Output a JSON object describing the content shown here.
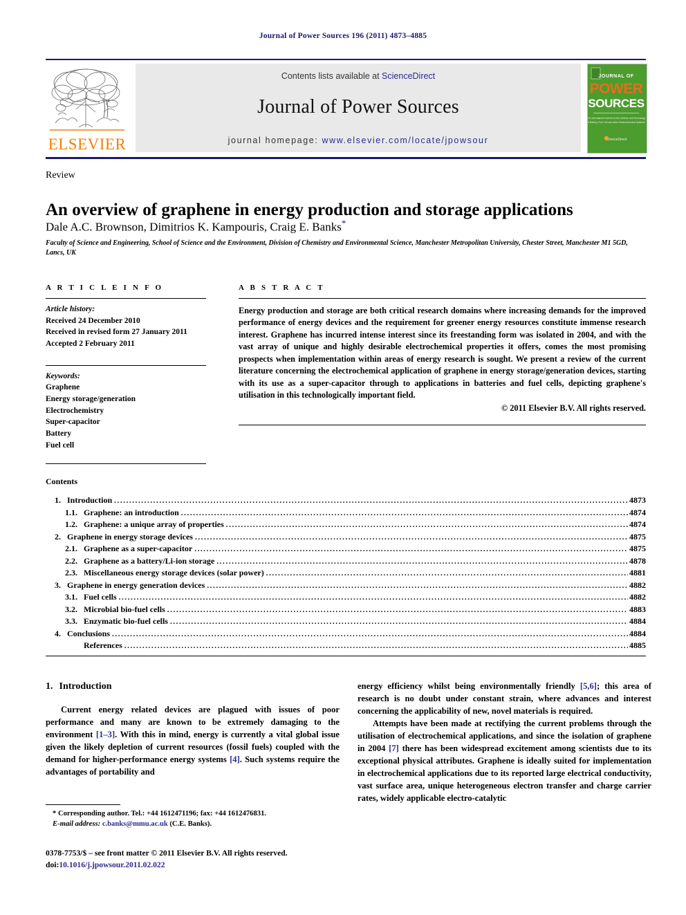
{
  "running_head": "Journal of Power Sources 196 (2011) 4873–4885",
  "masthead": {
    "contents_prefix": "Contents lists available at ",
    "sciencedirect": "ScienceDirect",
    "journal_name": "Journal of Power Sources",
    "homepage_prefix": "journal homepage: ",
    "homepage_url": "www.elsevier.com/locate/jpowsour",
    "publisher_logo_text": "ELSEVIER",
    "cover": {
      "line1": "JOURNAL OF",
      "line2": "POWER",
      "line3": "SOURCES",
      "blurb": "The International Journal on the Science and Technology of Battery, Fuel Cell and other Electrochemical Systems",
      "footer": "ScienceDirect"
    },
    "colors": {
      "elsevier_orange": "#F08000",
      "link_blue": "#2b2b8f",
      "rule_navy": "#1a1a6e",
      "cover_green": "#4c9c2e"
    }
  },
  "article": {
    "doctype": "Review",
    "title": "An overview of graphene in energy production and storage applications",
    "authors": "Dale A.C. Brownson, Dimitrios K. Kampouris, Craig E. Banks",
    "author_star": "*",
    "affiliation": "Faculty of Science and Engineering, School of Science and the Environment, Division of Chemistry and Environmental Science, Manchester Metropolitan University, Chester Street, Manchester M1 5GD, Lancs, UK"
  },
  "article_info": {
    "heading": "A R T I C L E    I N F O",
    "history_label": "Article history:",
    "history": [
      "Received 24 December 2010",
      "Received in revised form 27 January 2011",
      "Accepted 2 February 2011"
    ],
    "keywords_label": "Keywords:",
    "keywords": [
      "Graphene",
      "Energy storage/generation",
      "Electrochemistry",
      "Super-capacitor",
      "Battery",
      "Fuel cell"
    ]
  },
  "abstract": {
    "heading": "A B S T R A C T",
    "text": "Energy production and storage are both critical research domains where increasing demands for the improved performance of energy devices and the requirement for greener energy resources constitute immense research interest. Graphene has incurred intense interest since its freestanding form was isolated in 2004, and with the vast array of unique and highly desirable electrochemical properties it offers, comes the most promising prospects when implementation within areas of energy research is sought. We present a review of the current literature concerning the electrochemical application of graphene in energy storage/generation devices, starting with its use as a super-capacitor through to applications in batteries and fuel cells, depicting graphene's utilisation in this technologically important field.",
    "copyright": "© 2011 Elsevier B.V. All rights reserved."
  },
  "contents": {
    "heading": "Contents",
    "entries": [
      {
        "num": "1.",
        "label": "Introduction",
        "page": "4873",
        "level": 0
      },
      {
        "num": "1.1.",
        "label": "Graphene: an introduction",
        "page": "4874",
        "level": 1
      },
      {
        "num": "1.2.",
        "label": "Graphene: a unique array of properties",
        "page": "4874",
        "level": 1
      },
      {
        "num": "2.",
        "label": "Graphene in energy storage devices",
        "page": "4875",
        "level": 0
      },
      {
        "num": "2.1.",
        "label": "Graphene as a super-capacitor",
        "page": "4875",
        "level": 1
      },
      {
        "num": "2.2.",
        "label": "Graphene as a battery/Li-ion storage",
        "page": "4878",
        "level": 1
      },
      {
        "num": "2.3.",
        "label": "Miscellaneous energy storage devices (solar power)",
        "page": "4881",
        "level": 1
      },
      {
        "num": "3.",
        "label": "Graphene in energy generation devices",
        "page": "4882",
        "level": 0
      },
      {
        "num": "3.1.",
        "label": "Fuel cells",
        "page": "4882",
        "level": 1
      },
      {
        "num": "3.2.",
        "label": "Microbial bio-fuel cells",
        "page": "4883",
        "level": 1
      },
      {
        "num": "3.3.",
        "label": "Enzymatic bio-fuel cells",
        "page": "4884",
        "level": 1
      },
      {
        "num": "4.",
        "label": "Conclusions",
        "page": "4884",
        "level": 0
      },
      {
        "num": "",
        "label": "References",
        "page": "4885",
        "level": 1
      }
    ]
  },
  "body": {
    "section_number": "1.",
    "section_title": "Introduction",
    "left_paragraph_parts": {
      "p1_a": "Current energy related devices are plagued with issues of poor performance and many are known to be extremely damaging to the environment ",
      "p1_cite1": "[1–3]",
      "p1_b": ". With this in mind, energy is currently a vital global issue given the likely depletion of current resources (fossil fuels) coupled with the demand for higher-performance energy systems ",
      "p1_cite2": "[4]",
      "p1_c": ". Such systems require the advantages of portability and"
    },
    "right_paragraph_parts": {
      "p1_a": "energy efficiency whilst being environmentally friendly ",
      "p1_cite1": "[5,6]",
      "p1_b": "; this area of research is no doubt under constant strain, where advances and interest concerning the applicability of new, novel materials is required.",
      "p2_a": "Attempts have been made at rectifying the current problems through the utilisation of electrochemical applications, and since the isolation of graphene in 2004 ",
      "p2_cite1": "[7]",
      "p2_b": " there has been widespread excitement among scientists due to its exceptional physical attributes. Graphene is ideally suited for implementation in electrochemical applications due to its reported large electrical conductivity, vast surface area, unique heterogeneous electron transfer and charge carrier rates, widely applicable electro-catalytic"
    }
  },
  "footnotes": {
    "corresponding": "* Corresponding author. Tel.: +44 1612471196; fax: +44 1612476831.",
    "email_label": "E-mail address:",
    "email": "c.banks@mmu.ac.uk",
    "email_suffix": "(C.E. Banks).",
    "issn_line": "0378-7753/$ – see front matter © 2011 Elsevier B.V. All rights reserved.",
    "doi_label": "doi:",
    "doi": "10.1016/j.jpowsour.2011.02.022"
  }
}
